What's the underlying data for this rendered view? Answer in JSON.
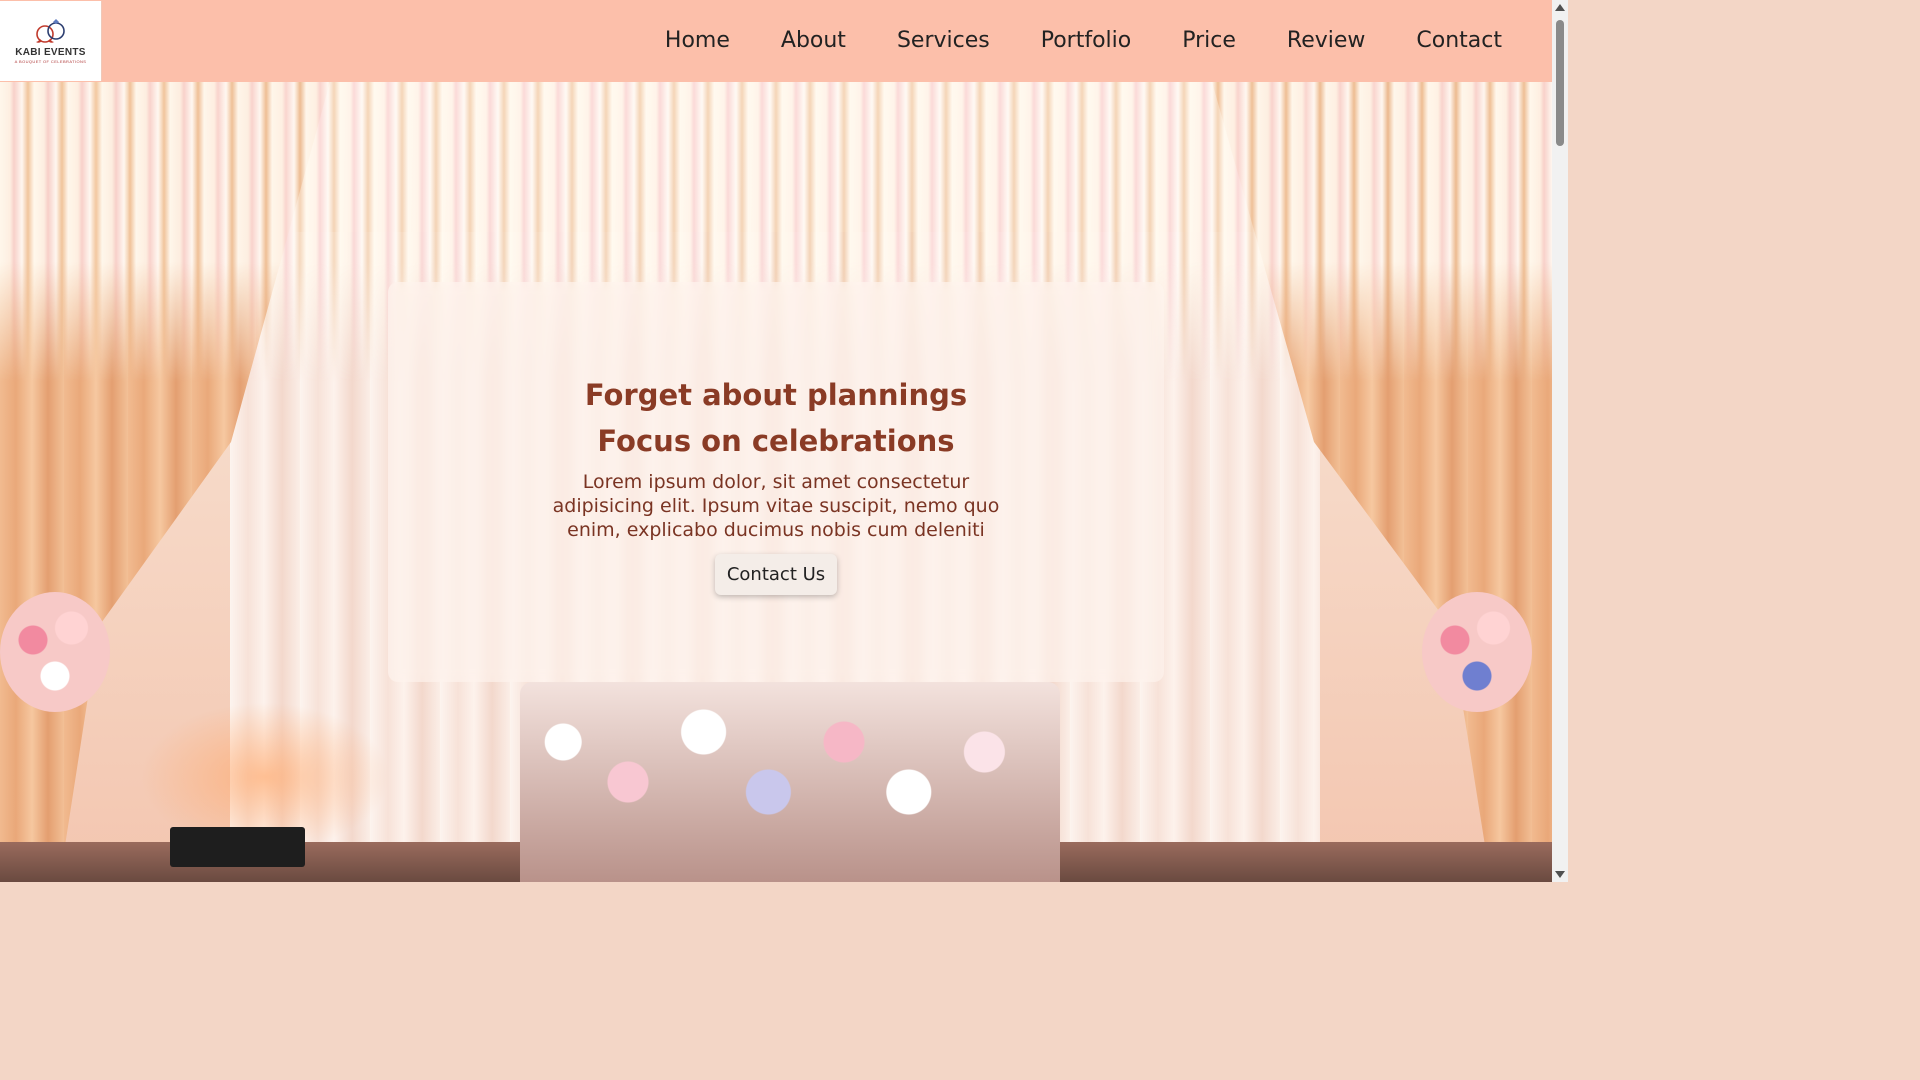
{
  "logo": {
    "name": "KABI EVENTS",
    "tagline": "A BOUQUET OF CELEBRATIONS"
  },
  "nav": {
    "items": [
      {
        "label": "Home"
      },
      {
        "label": "About"
      },
      {
        "label": "Services"
      },
      {
        "label": "Portfolio"
      },
      {
        "label": "Price"
      },
      {
        "label": "Review"
      },
      {
        "label": "Contact"
      }
    ]
  },
  "hero": {
    "title_line1": "Forget about plannings",
    "title_line2": "Focus on celebrations",
    "description": "Lorem ipsum dolor, sit amet consectetur adipisicing elit. Ipsum vitae suscipit, nemo quo enim, explicabo ducimus nobis cum deleniti",
    "button_label": "Contact Us"
  },
  "colors": {
    "navbar_bg": "#fcbfaa",
    "heading": "#8a3b25",
    "text": "#7a3423"
  }
}
